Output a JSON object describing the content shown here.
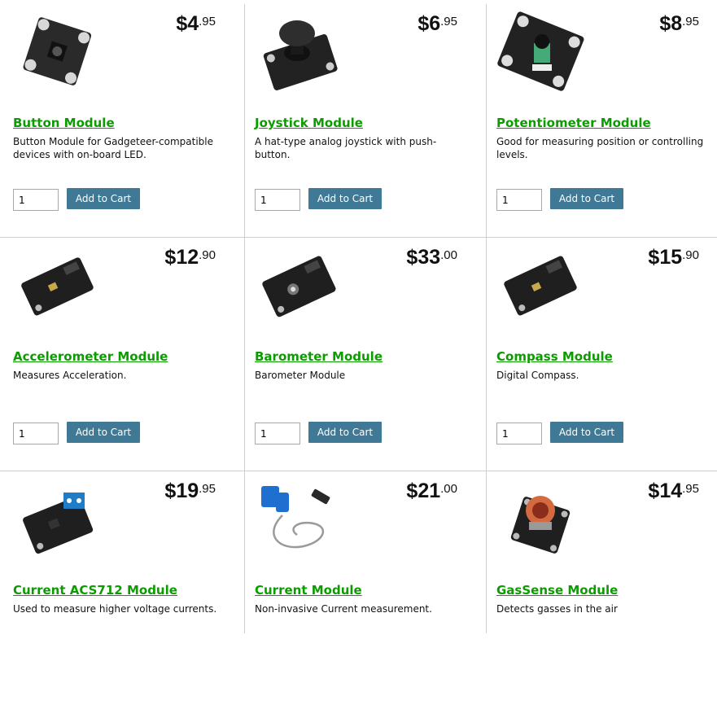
{
  "products": [
    {
      "title": "Button Module",
      "description": "Button Module for Gadgeteer-compatible devices with on-board LED.",
      "price_whole": "$4",
      "price_cents": ".95",
      "quantity": "1",
      "add_label": "Add to Cart",
      "image": "button-module-board-icon"
    },
    {
      "title": "Joystick Module",
      "description": "A hat-type analog joystick with push-button.",
      "price_whole": "$6",
      "price_cents": ".95",
      "quantity": "1",
      "add_label": "Add to Cart",
      "image": "joystick-module-board-icon"
    },
    {
      "title": "Potentiometer Module",
      "description": "Good for measuring position or controlling levels.",
      "price_whole": "$8",
      "price_cents": ".95",
      "quantity": "1",
      "add_label": "Add to Cart",
      "image": "potentiometer-module-board-icon"
    },
    {
      "title": "Accelerometer Module",
      "description": "Measures Acceleration.",
      "price_whole": "$12",
      "price_cents": ".90",
      "quantity": "1",
      "add_label": "Add to Cart",
      "image": "accelerometer-module-board-icon"
    },
    {
      "title": "Barometer Module",
      "description": "Barometer Module",
      "price_whole": "$33",
      "price_cents": ".00",
      "quantity": "1",
      "add_label": "Add to Cart",
      "image": "barometer-module-board-icon"
    },
    {
      "title": "Compass Module",
      "description": "Digital Compass.",
      "price_whole": "$15",
      "price_cents": ".90",
      "quantity": "1",
      "add_label": "Add to Cart",
      "image": "compass-module-board-icon"
    },
    {
      "title": "Current ACS712 Module",
      "description": "Used to measure higher voltage currents.",
      "price_whole": "$19",
      "price_cents": ".95",
      "image": "current-acs712-module-board-icon"
    },
    {
      "title": "Current Module",
      "description": "Non-invasive Current measurement.",
      "price_whole": "$21",
      "price_cents": ".00",
      "image": "current-clamp-sensor-icon"
    },
    {
      "title": "GasSense Module",
      "description": "Detects gasses in the air",
      "price_whole": "$14",
      "price_cents": ".95",
      "image": "gassense-module-board-icon"
    }
  ],
  "colors": {
    "title_link": "#0c9b00",
    "button_bg": "#3f7995",
    "grid_line": "#cfcfcf"
  }
}
